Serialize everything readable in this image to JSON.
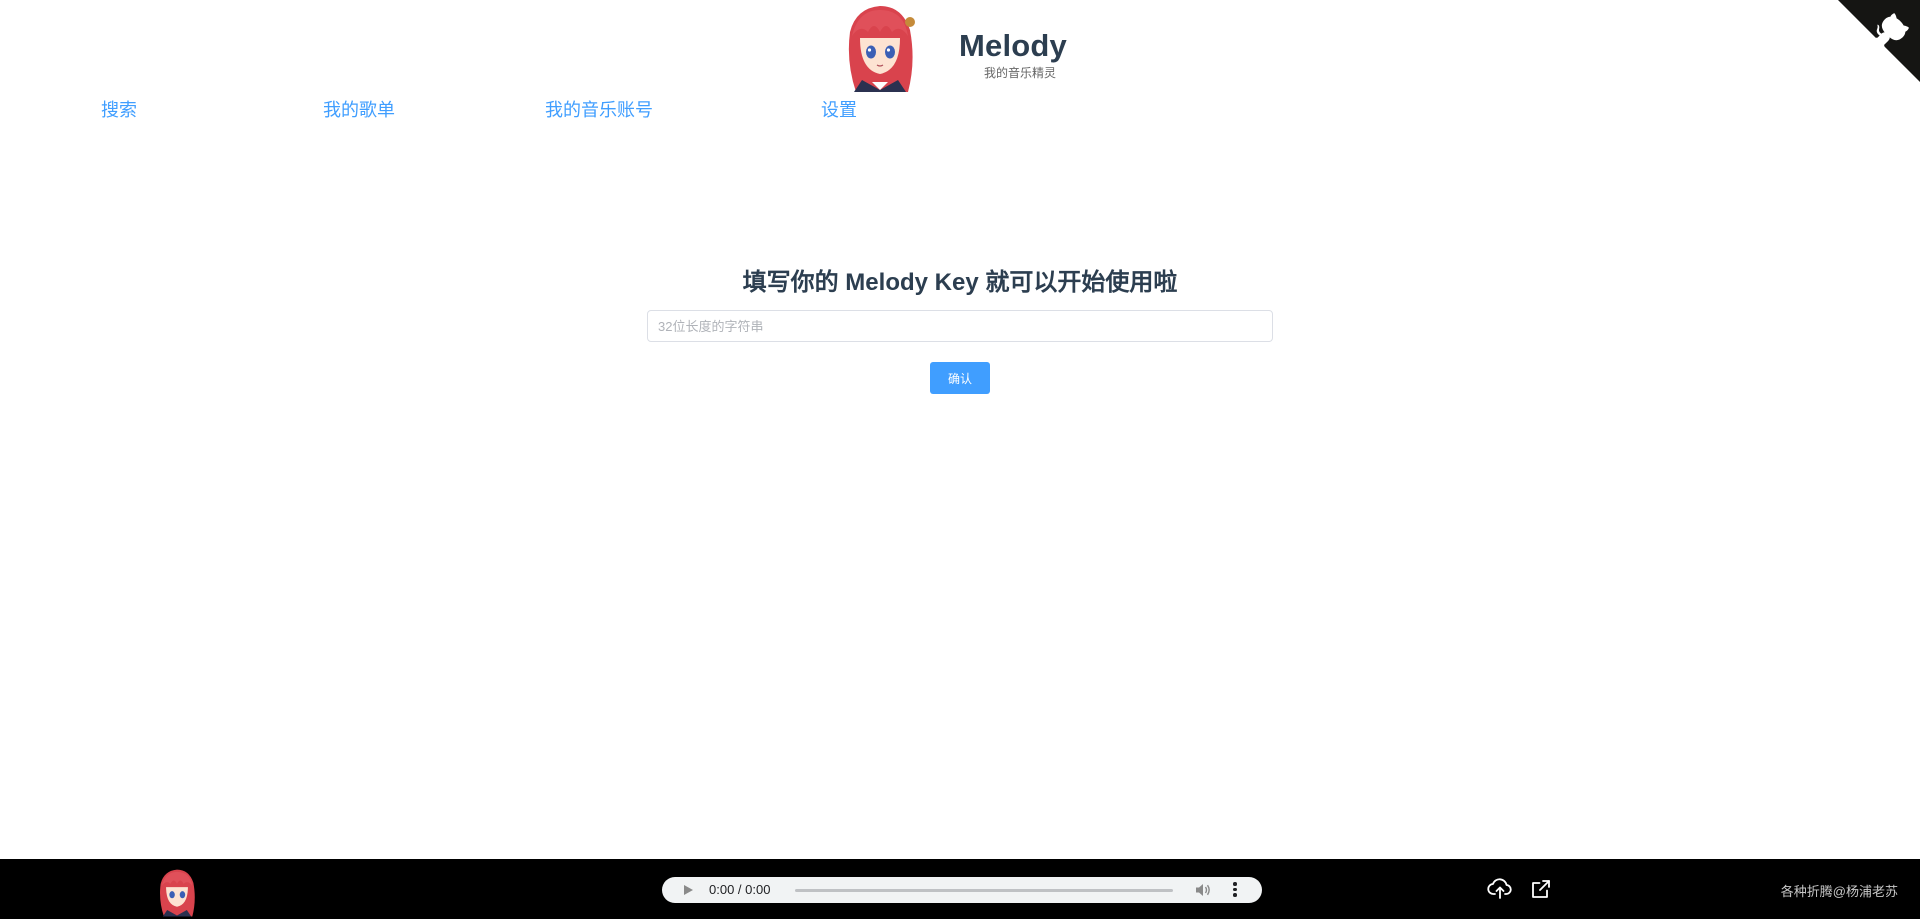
{
  "header": {
    "brand_title": "Melody",
    "brand_subtitle": "我的音乐精灵"
  },
  "nav": {
    "items": [
      {
        "label": "搜索"
      },
      {
        "label": "我的歌单"
      },
      {
        "label": "我的音乐账号"
      },
      {
        "label": "设置"
      }
    ]
  },
  "form": {
    "heading": "填写你的 Melody Key 就可以开始使用啦",
    "key_placeholder": "32位长度的字符串",
    "key_value": "",
    "confirm_label": "确认"
  },
  "player": {
    "time_display": "0:00 / 0:00",
    "progress": 0
  },
  "footer": {
    "credit": "各种折腾@杨浦老苏"
  },
  "colors": {
    "accent": "#409eff",
    "text_dark": "#2c3e50",
    "footer_bg": "#000000"
  },
  "icons": {
    "corner": "github-cat-icon",
    "upload": "cloud-upload-icon",
    "open": "external-link-icon",
    "play": "play-icon",
    "volume": "volume-icon",
    "more": "more-vertical-icon"
  }
}
